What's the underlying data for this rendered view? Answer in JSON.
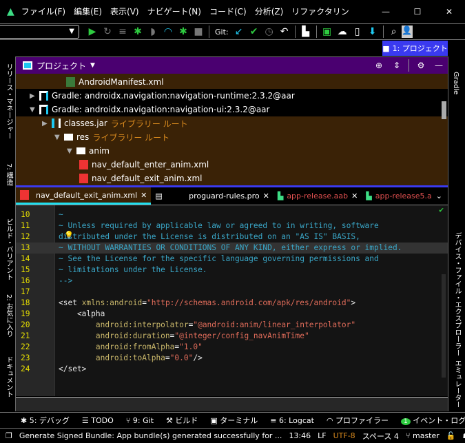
{
  "menu": [
    "ファイル(F)",
    "編集(E)",
    "表示(V)",
    "ナビゲート(N)",
    "コード(C)",
    "分析(Z)",
    "リファクタリン"
  ],
  "toolbar": {
    "git_label": "Git:"
  },
  "project_tab": "1: プロジェクト",
  "left_tools": [
    "リリース・マネージャー",
    "7: 構造",
    "ビルド・バリアント",
    "2: お気に入り",
    "ドキュメント"
  ],
  "right_tools": [
    "Gradle",
    "デバイス・ファイル・エクスプローラー",
    "エミュレーター"
  ],
  "project_panel": {
    "title": "プロジェクト",
    "tree": [
      {
        "label": "AndroidManifest.xml",
        "icon": "manifest-icon"
      },
      {
        "label": "Gradle: androidx.navigation:navigation-runtime:2.3.2@aar",
        "icon": "library-icon",
        "expanded": false
      },
      {
        "label": "Gradle: androidx.navigation:navigation-ui:2.3.2@aar",
        "icon": "library-icon",
        "expanded": true
      },
      {
        "label": "classes.jar",
        "suffix": "ライブラリー ルート",
        "icon": "jar-icon",
        "expanded": false
      },
      {
        "label": "res",
        "suffix": "ライブラリー ルート",
        "icon": "folder-icon",
        "expanded": true
      },
      {
        "label": "anim",
        "icon": "folder-icon",
        "expanded": true
      },
      {
        "label": "nav_default_enter_anim.xml",
        "icon": "xml-file-icon"
      },
      {
        "label": "nav_default_exit_anim.xml",
        "icon": "xml-file-icon"
      }
    ]
  },
  "tabs": [
    {
      "label": "nav_default_exit_anim.xml",
      "active": true
    },
    {
      "label": ""
    },
    {
      "label": "proguard-rules.pro"
    },
    {
      "label": "app-release.aab"
    },
    {
      "label": "app-release5.a"
    }
  ],
  "editor": {
    "lines": [
      {
        "n": "10",
        "t": "~"
      },
      {
        "n": "11",
        "t": "~ Unless required by applicable law or agreed to in writing, software"
      },
      {
        "n": "12",
        "t": "distributed under the License is distributed on an \"AS IS\" BASIS,"
      },
      {
        "n": "13",
        "t": "~ WITHOUT WARRANTIES OR CONDITIONS OF ANY KIND, either express or implied."
      },
      {
        "n": "14",
        "t": "~ See the License for the specific language governing permissions and"
      },
      {
        "n": "15",
        "t": "~ limitations under the License."
      },
      {
        "n": "16",
        "t": "-->"
      },
      {
        "n": "17",
        "t": ""
      },
      {
        "n": "18",
        "a": "<set ",
        "b": "xmlns:android",
        "c": "=",
        "d": "\"http://schemas.android.com/apk/res/android\"",
        "e": ">"
      },
      {
        "n": "19",
        "a": "    <alpha"
      },
      {
        "n": "20",
        "b": "        android:interpolator",
        "c": "=",
        "d": "\"@android:anim/linear_interpolator\""
      },
      {
        "n": "21",
        "b": "        android:duration",
        "c": "=",
        "d": "\"@integer/config_navAnimTime\""
      },
      {
        "n": "22",
        "b": "        android:fromAlpha",
        "c": "=",
        "d": "\"1.0\""
      },
      {
        "n": "23",
        "b": "        android:toAlpha",
        "c": "=",
        "d": "\"0.0\"",
        "e": "/>"
      },
      {
        "n": "24",
        "a": "</set>"
      }
    ]
  },
  "bottom_tools": [
    "5: デバッグ",
    "TODO",
    "9: Git",
    "ビルド",
    "ターミナル",
    "6: Logcat",
    "プロファイラー",
    "イベント・ログ"
  ],
  "event_count": "1",
  "status": {
    "message": "Generate Signed Bundle: App bundle(s) generated successfully for ...",
    "position": "13:46",
    "line_sep": "LF",
    "encoding": "UTF-8",
    "indent": "スペース 4",
    "branch": "master"
  }
}
